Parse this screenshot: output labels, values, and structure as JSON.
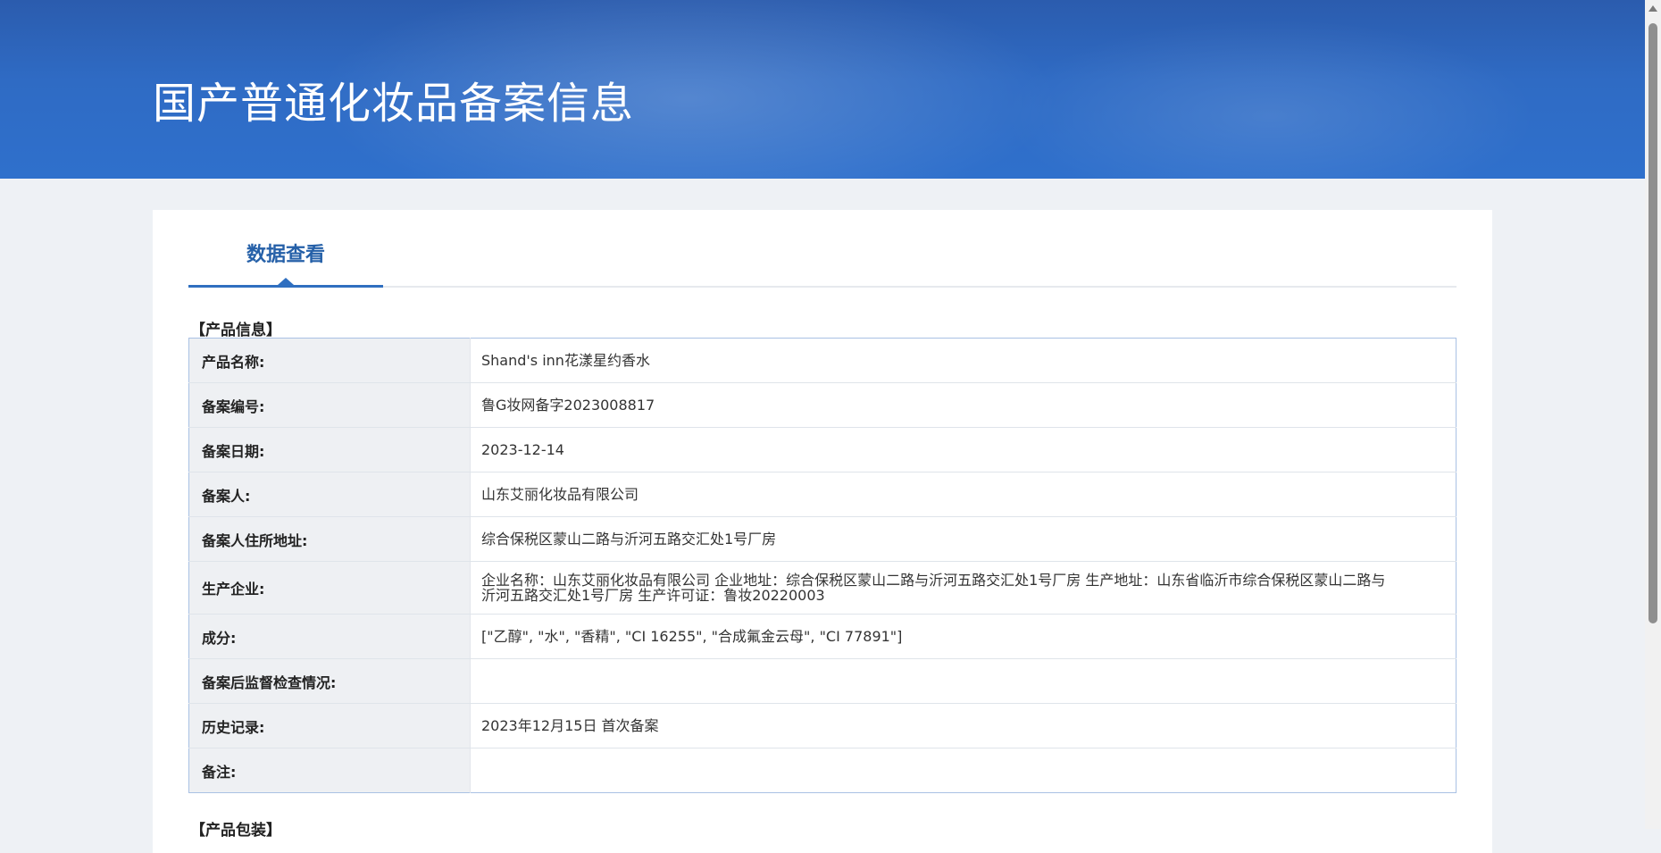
{
  "page": {
    "banner_title": "国产普通化妆品备案信息",
    "tab_label": "数据查看"
  },
  "product_info": {
    "section_title": "【产品信息】",
    "rows": [
      {
        "label": "产品名称:",
        "value": "Shand's inn花漾星约香水"
      },
      {
        "label": "备案编号:",
        "value": "鲁G妆网备字2023008817"
      },
      {
        "label": "备案日期:",
        "value": "2023-12-14"
      },
      {
        "label": "备案人:",
        "value": "山东艾丽化妆品有限公司"
      },
      {
        "label": "备案人住所地址:",
        "value": "综合保税区蒙山二路与沂河五路交汇处1号厂房"
      },
      {
        "label": "生产企业:",
        "value": "企业名称：山东艾丽化妆品有限公司 企业地址：综合保税区蒙山二路与沂河五路交汇处1号厂房 生产地址：山东省临沂市综合保税区蒙山二路与沂河五路交汇处1号厂房 生产许可证：鲁妆20220003"
      },
      {
        "label": "成分:",
        "value": "[\"乙醇\", \"水\", \"香精\", \"CI 16255\", \"合成氟金云母\", \"CI 77891\"]"
      },
      {
        "label": "备案后监督检查情况:",
        "value": ""
      },
      {
        "label": "历史记录:",
        "value": "2023年12月15日 首次备案"
      },
      {
        "label": "备注:",
        "value": ""
      }
    ]
  },
  "packaging": {
    "section_title": "【产品包装】"
  },
  "colors": {
    "banner": "#2f6bc4",
    "accent": "#2560a8",
    "table_border": "#a9c1e4",
    "label_bg": "#eef0f3"
  }
}
